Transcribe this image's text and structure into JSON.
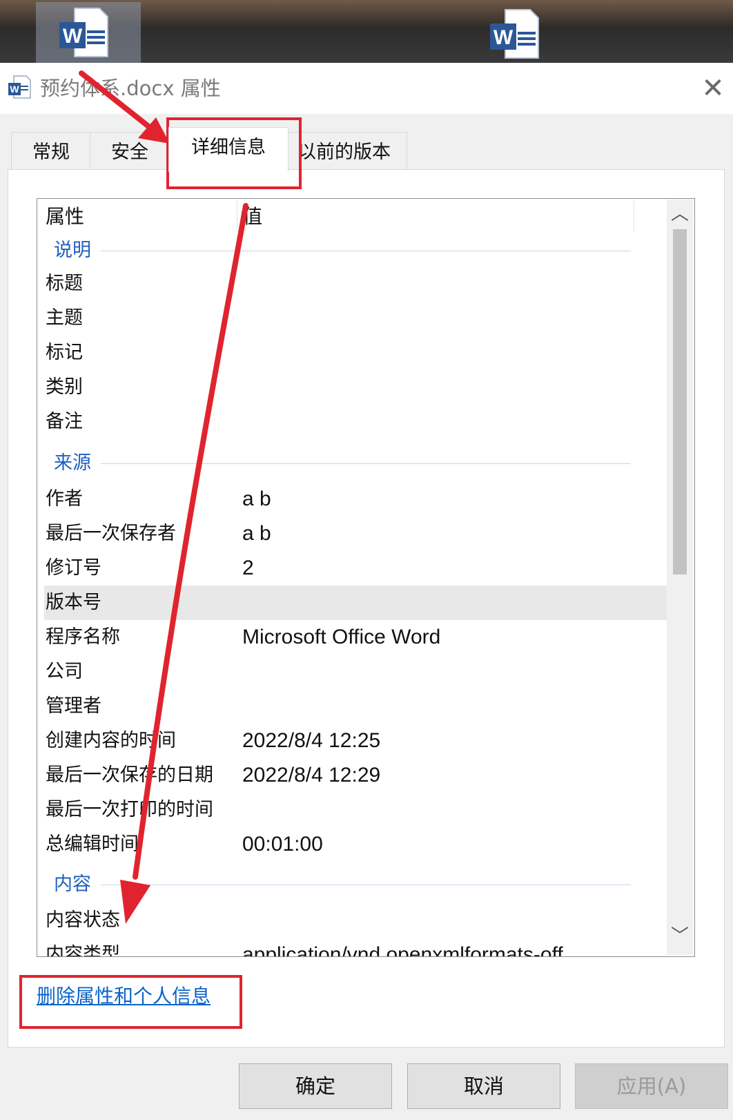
{
  "window": {
    "title": "预约体系.docx 属性",
    "close_icon": "close-icon"
  },
  "tabs": [
    {
      "label": "常规"
    },
    {
      "label": "安全"
    },
    {
      "label": "详细信息",
      "selected": true
    },
    {
      "label": "以前的版本"
    }
  ],
  "details": {
    "column_headers": {
      "property": "属性",
      "value": "值"
    },
    "groups": {
      "description": {
        "label": "说明",
        "rows": [
          {
            "key": "标题",
            "value": ""
          },
          {
            "key": "主题",
            "value": ""
          },
          {
            "key": "标记",
            "value": ""
          },
          {
            "key": "类别",
            "value": ""
          },
          {
            "key": "备注",
            "value": ""
          }
        ]
      },
      "origin": {
        "label": "来源",
        "rows": [
          {
            "key": "作者",
            "value": "a b"
          },
          {
            "key": "最后一次保存者",
            "value": "a b"
          },
          {
            "key": "修订号",
            "value": "2"
          },
          {
            "key": "版本号",
            "value": ""
          },
          {
            "key": "程序名称",
            "value": "Microsoft Office Word"
          },
          {
            "key": "公司",
            "value": ""
          },
          {
            "key": "管理者",
            "value": ""
          },
          {
            "key": "创建内容的时间",
            "value": "2022/8/4 12:25"
          },
          {
            "key": "最后一次保存的日期",
            "value": "2022/8/4 12:29"
          },
          {
            "key": "最后一次打印的时间",
            "value": ""
          },
          {
            "key": "总编辑时间",
            "value": "00:01:00"
          }
        ]
      },
      "content": {
        "label": "内容",
        "rows": [
          {
            "key": "内容状态",
            "value": ""
          },
          {
            "key": "内容类型",
            "value": "application/vnd.openxmlformats-off"
          }
        ]
      }
    }
  },
  "remove_link": "删除属性和个人信息",
  "buttons": {
    "ok": "确定",
    "cancel": "取消",
    "apply": "应用(A)"
  },
  "colors": {
    "annotation": "#e0242f",
    "link": "#0b63c9",
    "group_label": "#1f5fbf"
  }
}
